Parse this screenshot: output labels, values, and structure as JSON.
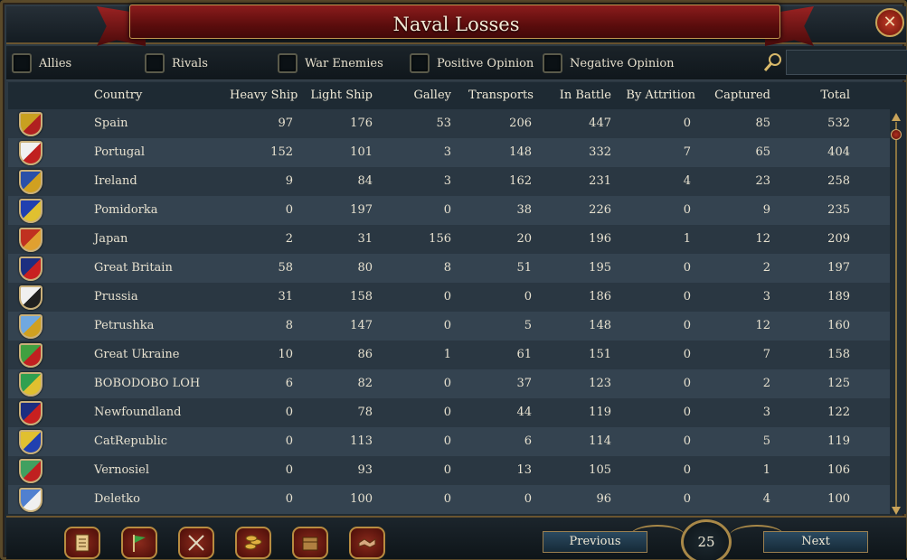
{
  "window": {
    "title": "Naval Losses",
    "close_icon": "close-icon"
  },
  "filters": [
    {
      "label": "Allies",
      "checked": false
    },
    {
      "label": "Rivals",
      "checked": false
    },
    {
      "label": "War Enemies",
      "checked": false
    },
    {
      "label": "Positive Opinion",
      "checked": false
    },
    {
      "label": "Negative Opinion",
      "checked": false
    }
  ],
  "search": {
    "value": "",
    "placeholder": ""
  },
  "columns": {
    "country": "Country",
    "heavy": "Heavy Ship",
    "light": "Light Ship",
    "galley": "Galley",
    "transports": "Transports",
    "battle": "In Battle",
    "attrition": "By Attrition",
    "captured": "Captured",
    "total": "Total"
  },
  "rows": [
    {
      "country": "Spain",
      "heavy": "97",
      "light": "176",
      "galley": "53",
      "transports": "206",
      "battle": "447",
      "attrition": "0",
      "captured": "85",
      "total": "532",
      "flag_colors": [
        "#c8a020",
        "#b02020"
      ]
    },
    {
      "country": "Portugal",
      "heavy": "152",
      "light": "101",
      "galley": "3",
      "transports": "148",
      "battle": "332",
      "attrition": "7",
      "captured": "65",
      "total": "404",
      "flag_colors": [
        "#f0f0f0",
        "#c02020"
      ]
    },
    {
      "country": "Ireland",
      "heavy": "9",
      "light": "84",
      "galley": "3",
      "transports": "162",
      "battle": "231",
      "attrition": "4",
      "captured": "23",
      "total": "258",
      "flag_colors": [
        "#2a50a8",
        "#d0a020"
      ]
    },
    {
      "country": "Pomidorka",
      "heavy": "0",
      "light": "197",
      "galley": "0",
      "transports": "38",
      "battle": "226",
      "attrition": "0",
      "captured": "9",
      "total": "235",
      "flag_colors": [
        "#2040b0",
        "#e0c030"
      ]
    },
    {
      "country": "Japan",
      "heavy": "2",
      "light": "31",
      "galley": "156",
      "transports": "20",
      "battle": "196",
      "attrition": "1",
      "captured": "12",
      "total": "209",
      "flag_colors": [
        "#c03020",
        "#e0a030"
      ]
    },
    {
      "country": "Great Britain",
      "heavy": "58",
      "light": "80",
      "galley": "8",
      "transports": "51",
      "battle": "195",
      "attrition": "0",
      "captured": "2",
      "total": "197",
      "flag_colors": [
        "#1c2e80",
        "#c82020"
      ]
    },
    {
      "country": "Prussia",
      "heavy": "31",
      "light": "158",
      "galley": "0",
      "transports": "0",
      "battle": "186",
      "attrition": "0",
      "captured": "3",
      "total": "189",
      "flag_colors": [
        "#f0f0f0",
        "#202020"
      ]
    },
    {
      "country": "Petrushka",
      "heavy": "8",
      "light": "147",
      "galley": "0",
      "transports": "5",
      "battle": "148",
      "attrition": "0",
      "captured": "12",
      "total": "160",
      "flag_colors": [
        "#70a8e0",
        "#d0a020"
      ]
    },
    {
      "country": "Great Ukraine",
      "heavy": "10",
      "light": "86",
      "galley": "1",
      "transports": "61",
      "battle": "151",
      "attrition": "0",
      "captured": "7",
      "total": "158",
      "flag_colors": [
        "#40a040",
        "#c02020"
      ]
    },
    {
      "country": "BOBODOBO LOH",
      "heavy": "6",
      "light": "82",
      "galley": "0",
      "transports": "37",
      "battle": "123",
      "attrition": "0",
      "captured": "2",
      "total": "125",
      "flag_colors": [
        "#30a050",
        "#e0c030"
      ]
    },
    {
      "country": "Newfoundland",
      "heavy": "0",
      "light": "78",
      "galley": "0",
      "transports": "44",
      "battle": "119",
      "attrition": "0",
      "captured": "3",
      "total": "122",
      "flag_colors": [
        "#1c2e80",
        "#c82020"
      ]
    },
    {
      "country": "CatRepublic",
      "heavy": "0",
      "light": "113",
      "galley": "0",
      "transports": "6",
      "battle": "114",
      "attrition": "0",
      "captured": "5",
      "total": "119",
      "flag_colors": [
        "#e0c030",
        "#2040b0"
      ]
    },
    {
      "country": "Vernosiel",
      "heavy": "0",
      "light": "93",
      "galley": "0",
      "transports": "13",
      "battle": "105",
      "attrition": "0",
      "captured": "1",
      "total": "106",
      "flag_colors": [
        "#40a060",
        "#c02020"
      ]
    },
    {
      "country": "Deletko",
      "heavy": "0",
      "light": "100",
      "galley": "0",
      "transports": "0",
      "battle": "96",
      "attrition": "0",
      "captured": "4",
      "total": "100",
      "flag_colors": [
        "#5080d0",
        "#f0f0f0"
      ]
    }
  ],
  "bottom_tabs": [
    {
      "icon": "scroll-icon"
    },
    {
      "icon": "flag-icon"
    },
    {
      "icon": "crossed-swords-icon"
    },
    {
      "icon": "coins-icon"
    },
    {
      "icon": "crate-icon"
    },
    {
      "icon": "handshake-icon"
    }
  ],
  "pagination": {
    "previous_label": "Previous",
    "next_label": "Next",
    "page": "25"
  }
}
